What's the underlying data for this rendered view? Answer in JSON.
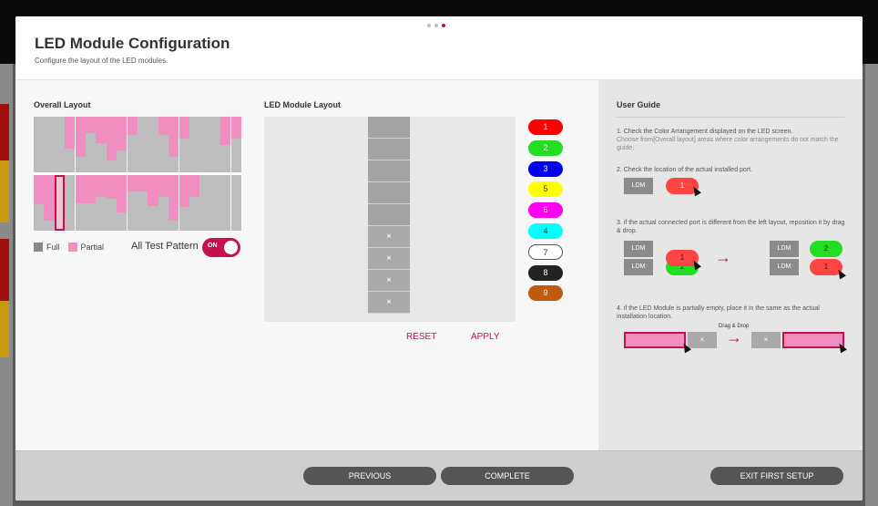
{
  "header": {
    "title": "LED Module Configuration",
    "subtitle": "Configure the layout of the LED modules."
  },
  "pagination": {
    "total": 3,
    "current": 3
  },
  "overall": {
    "title": "Overall Layout",
    "top_fills": [
      0,
      0,
      0,
      0.58,
      0.72,
      0.3,
      0.48,
      0.78,
      0.6,
      0.32,
      0,
      0,
      0.32,
      0.72,
      0.4,
      0,
      0,
      0,
      0.5,
      0.4
    ],
    "bottom_fills": [
      0.52,
      0.82,
      0,
      0,
      0.5,
      0.5,
      0.4,
      0.42,
      0.68,
      0.3,
      0.3,
      0.55,
      0.4,
      0.82,
      0.58,
      0.4,
      0,
      0,
      0,
      0
    ],
    "selected_col": 2,
    "legend_full": "Full",
    "legend_partial": "Partial",
    "all_test_label": "All Test Pattern",
    "toggle_label": "ON"
  },
  "module": {
    "title": "LED Module Layout",
    "cells": [
      "",
      "",
      "",
      "",
      "",
      "×",
      "×",
      "×",
      "×"
    ],
    "reset_label": "RESET",
    "apply_label": "APPLY"
  },
  "ports": [
    {
      "label": "1",
      "bg": "#ff0000",
      "fg": "#fff"
    },
    {
      "label": "2",
      "bg": "#22dd22",
      "fg": "#fff"
    },
    {
      "label": "3",
      "bg": "#0000ee",
      "fg": "#fff"
    },
    {
      "label": "5",
      "bg": "#ffff00",
      "fg": "#333"
    },
    {
      "label": "6",
      "bg": "#ff00ee",
      "fg": "#fff"
    },
    {
      "label": "4",
      "bg": "#00ffff",
      "fg": "#333"
    },
    {
      "label": "7",
      "bg": "#ffffff",
      "fg": "#333"
    },
    {
      "label": "8",
      "bg": "#222222",
      "fg": "#fff"
    },
    {
      "label": "9",
      "bg": "#c05a10",
      "fg": "#fff"
    }
  ],
  "guide": {
    "title": "User Guide",
    "step1": "1. Check the Color Arrangement displayed on the LED screen.",
    "step1_sub": "Choose from[Overall layout] areas where color arrangements do not match the guide.",
    "step2": "2. Check the location of the actual installed port.",
    "step3": "3. if the actual connected port is different from the left layout, reposition it by drag & drop.",
    "step4": "4. if the LED Module is partially empty, place it in the same as the actual installation location.",
    "ldm": "LDM",
    "one": "1",
    "two": "2",
    "drag_drop": "Drag & Drop",
    "x": "×"
  },
  "footer": {
    "previous": "PREVIOUS",
    "complete": "COMPLETE",
    "exit": "EXIT FIRST SETUP"
  },
  "colors": {
    "accent": "#d10a50",
    "pink": "#f08ec0",
    "grey": "#bdbdbd"
  }
}
